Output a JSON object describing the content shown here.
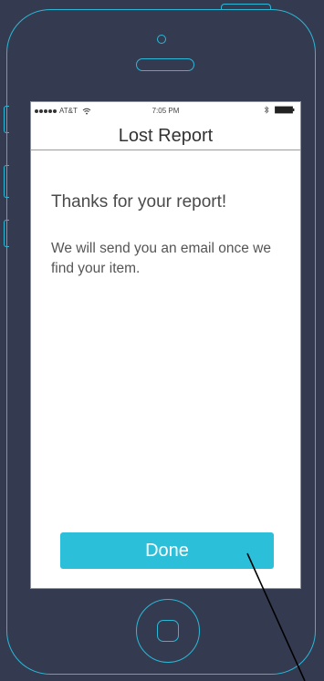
{
  "status_bar": {
    "carrier": "AT&T",
    "time": "7:05 PM",
    "icons": [
      "signal-dots-icon",
      "wifi-icon",
      "bluetooth-icon",
      "battery-icon"
    ]
  },
  "nav": {
    "title": "Lost Report"
  },
  "content": {
    "heading": "Thanks for your report!",
    "body": "We will send you an email once we find your item."
  },
  "actions": {
    "done_label": "Done"
  },
  "colors": {
    "background": "#343b51",
    "outline": "#2bb8d6",
    "button": "#2bbfd9",
    "screen": "#ffffff"
  }
}
